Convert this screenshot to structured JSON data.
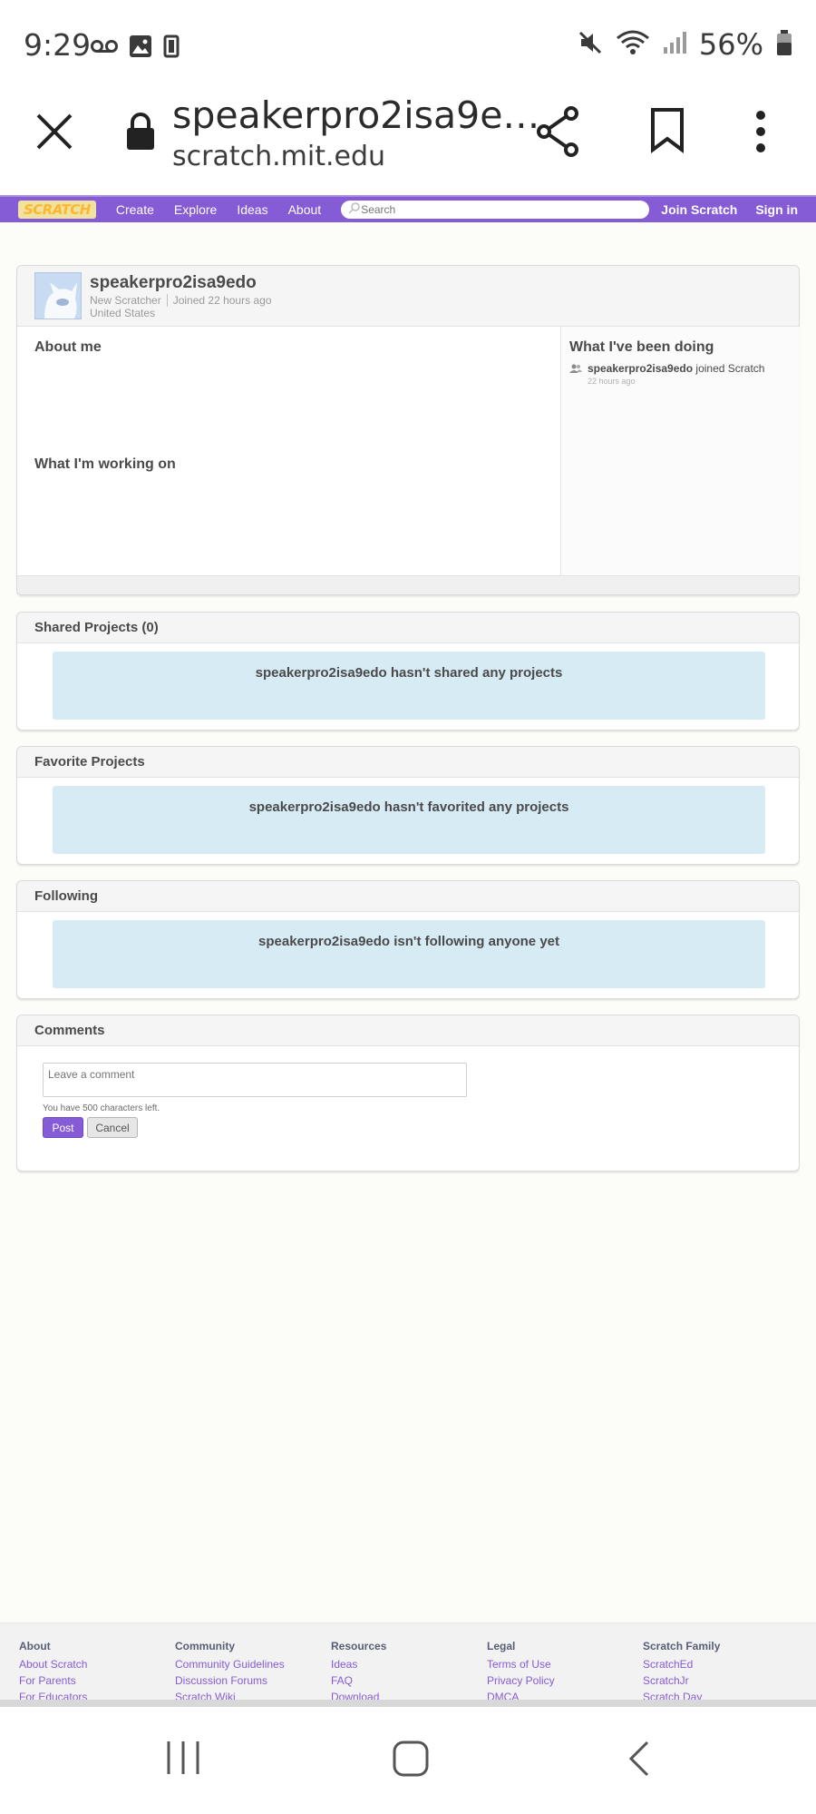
{
  "status_bar": {
    "time": "9:29",
    "battery_percent": "56%"
  },
  "browser": {
    "page_title": "speakerpro2isa9e…",
    "domain": "scratch.mit.edu"
  },
  "nav": {
    "logo": "SCRATCH",
    "links": [
      "Create",
      "Explore",
      "Ideas",
      "About"
    ],
    "search_placeholder": "Search",
    "join": "Join Scratch",
    "signin": "Sign in",
    "accent_color": "#855cd6"
  },
  "profile": {
    "username": "speakerpro2isa9edo",
    "rank": "New Scratcher",
    "joined": "Joined 22 hours ago",
    "country": "United States",
    "about_title": "About me",
    "working_title": "What I'm working on",
    "doing_title": "What I've been doing",
    "activity": {
      "user": "speakerpro2isa9edo",
      "action": "joined Scratch",
      "time": "22 hours ago"
    }
  },
  "shared": {
    "title": "Shared Projects (0)",
    "empty": "speakerpro2isa9edo hasn't shared any projects"
  },
  "favorite": {
    "title": "Favorite Projects",
    "empty": "speakerpro2isa9edo hasn't favorited any projects"
  },
  "following": {
    "title": "Following",
    "empty": "speakerpro2isa9edo isn't following anyone yet"
  },
  "comments": {
    "title": "Comments",
    "placeholder": "Leave a comment",
    "chars_left": "You have 500 characters left.",
    "post": "Post",
    "cancel": "Cancel"
  },
  "footer": {
    "columns": [
      {
        "title": "About",
        "links": [
          "About Scratch",
          "For Parents",
          "For Educators"
        ]
      },
      {
        "title": "Community",
        "links": [
          "Community Guidelines",
          "Discussion Forums",
          "Scratch Wiki"
        ]
      },
      {
        "title": "Resources",
        "links": [
          "Ideas",
          "FAQ",
          "Download"
        ]
      },
      {
        "title": "Legal",
        "links": [
          "Terms of Use",
          "Privacy Policy",
          "DMCA"
        ]
      },
      {
        "title": "Scratch Family",
        "links": [
          "ScratchEd",
          "ScratchJr",
          "Scratch Day"
        ]
      }
    ]
  }
}
